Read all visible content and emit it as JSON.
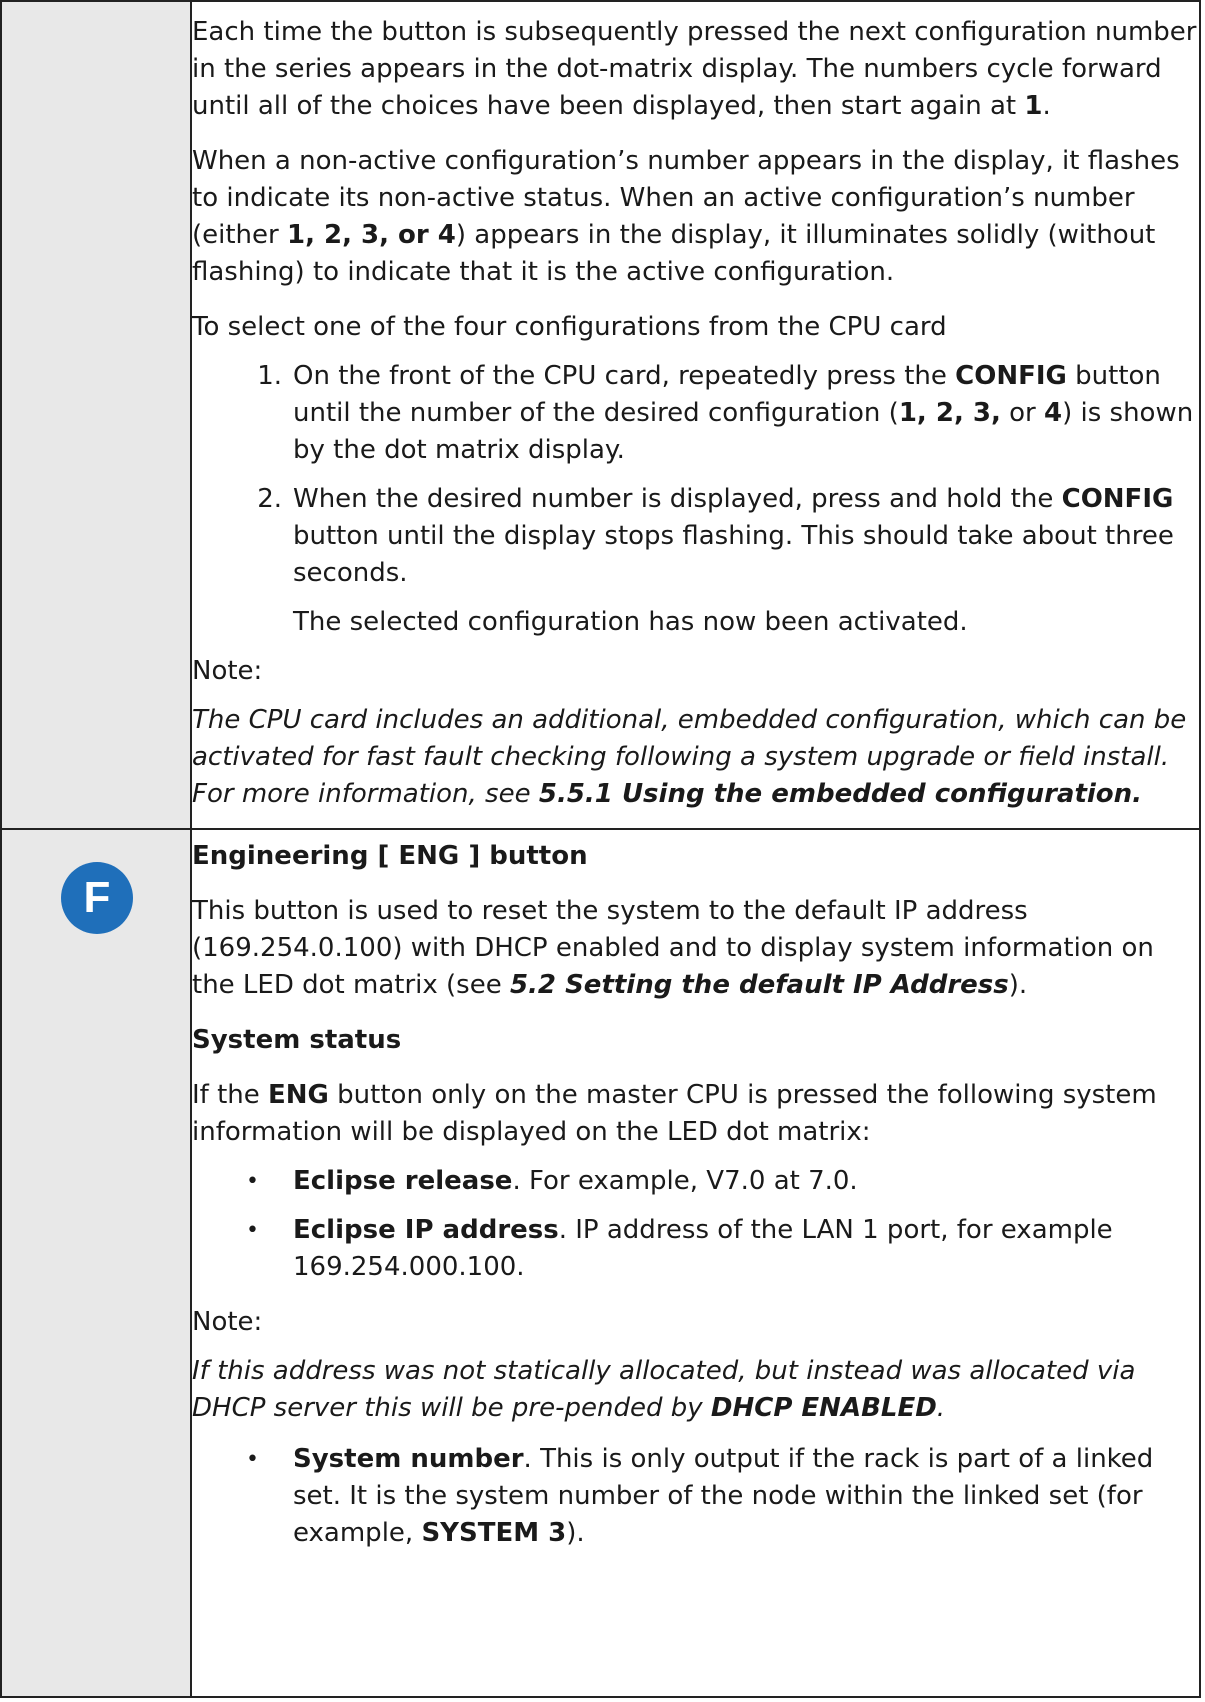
{
  "row1": {
    "p1_a": "Each time the button is subsequently pressed the next configuration number in the series appears in the dot-matrix display. The numbers cycle forward until all of the choices have been displayed, then start again at ",
    "p1_b": "1",
    "p1_c": ".",
    "p2_a": "When a non-active configuration’s number appears in the display, it flashes to indicate its non-active status. When an active configuration’s number (either ",
    "p2_b": "1, 2, 3, or 4",
    "p2_c": ") appears in the display, it illuminates solidly (without flashing) to indicate that it is the active configuration.",
    "intro": "To select one of the four configurations from the CPU card",
    "step1": {
      "num": "1.",
      "a": "On the front of the CPU card, repeatedly press the ",
      "b": "CONFIG",
      "c": " button until the number of the desired configuration (",
      "d": "1, 2, 3,",
      "e": " or ",
      "f": "4",
      "g": ") is shown by the dot matrix display."
    },
    "step2": {
      "num": "2.",
      "a": "When the desired number is displayed, press and hold the ",
      "b": "CONFIG",
      "c": " button until the display stops flashing. This should take about three seconds."
    },
    "activated": "The selected configuration has now been activated.",
    "note_label": "Note:",
    "note_a": "The CPU card includes an additional, embedded configuration, which can be activated for fast fault checking following a system upgrade or field install. For more information, see ",
    "note_b": "5.5.1 Using the embedded configuration."
  },
  "row2": {
    "badge": "F",
    "heading": "Engineering [ ENG ] button",
    "p1_a": "This button is used to reset the system to the default IP address (169.254.0.100) with DHCP enabled and to display system information on the LED dot matrix (see ",
    "p1_b": "5.2 Setting the default IP Address",
    "p1_c": ").",
    "subheading": "System status",
    "p2_a": "If the ",
    "p2_b": "ENG",
    "p2_c": " button only on the master CPU is pressed the following system information will be displayed on the LED dot matrix:",
    "bullet_char": "•",
    "b1_a": "Eclipse release",
    "b1_b": ". For example, V7.0 at 7.0.",
    "b2_a": "Eclipse IP address",
    "b2_b": ". IP address of the LAN 1 port, for example 169.254.000.100.",
    "note_label": "Note:",
    "note_a": "If this address was not statically allocated, but instead was allocated via DHCP server this will be pre-pended by ",
    "note_b": "DHCP ENABLED",
    "note_c": ".",
    "b3_a": "System number",
    "b3_b": ". This is only output if the rack is part of a linked set. It is the system number of the node within the linked set (for example, ",
    "b3_c": "SYSTEM 3",
    "b3_d": ")."
  },
  "colors": {
    "badge": "#1f6fba",
    "left_cell": "#e8e8e8",
    "border": "#222222"
  }
}
